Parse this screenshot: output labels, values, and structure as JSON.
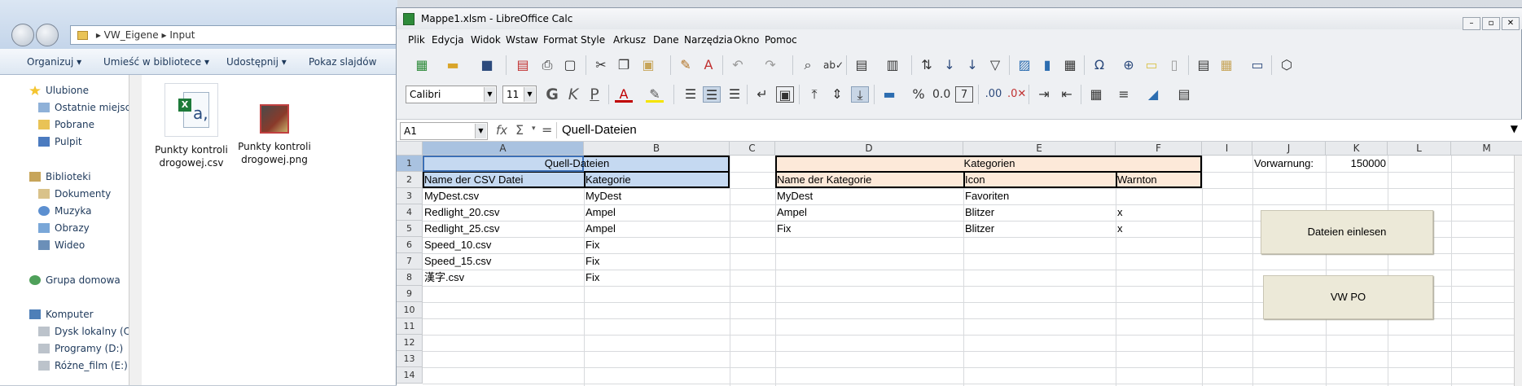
{
  "explorer": {
    "breadcrumb": [
      "VW_Eigene",
      "Input"
    ],
    "toolbar": [
      "Organizuj",
      "Umieść w bibliotece",
      "Udostępnij",
      "Pokaz slajdów"
    ],
    "nav": {
      "favorites": "Ulubione",
      "favorites_items": [
        "Ostatnie miejsca",
        "Pobrane",
        "Pulpit"
      ],
      "libraries": "Biblioteki",
      "libraries_items": [
        "Dokumenty",
        "Muzyka",
        "Obrazy",
        "Wideo"
      ],
      "homegroup": "Grupa domowa",
      "computer": "Komputer",
      "computer_items": [
        "Dysk lokalny (C:)",
        "Programy (D:)",
        "Różne_film (E:)"
      ]
    },
    "files": [
      {
        "name_line1": "Punkty kontroli",
        "name_line2": "drogowej.csv",
        "icon": "excel-csv-icon"
      },
      {
        "name_line1": "Punkty kontroli",
        "name_line2": "drogowej.png",
        "icon": "image-thumbnail"
      }
    ]
  },
  "calc": {
    "title": "Mappe1.xlsm - LibreOffice Calc",
    "menu": [
      "Plik",
      "Edycja",
      "Widok",
      "Wstaw",
      "Format",
      "Style",
      "Arkusz",
      "Dane",
      "Narzędzia",
      "Okno",
      "Pomoc"
    ],
    "font_name": "Calibri",
    "font_size": "11",
    "name_box": "A1",
    "formula": "Quell-Dateien",
    "columns": [
      "A",
      "B",
      "C",
      "D",
      "E",
      "F",
      "I",
      "J",
      "K",
      "L",
      "M"
    ],
    "rows": [
      "1",
      "2",
      "3",
      "4",
      "5",
      "6",
      "7",
      "8",
      "9",
      "10",
      "11",
      "12",
      "13",
      "14"
    ],
    "cells": {
      "A1": "Quell-Dateien",
      "A2": "Name der CSV Datei",
      "B2": "Kategorie",
      "D1": "Kategorien",
      "D2": "Name der Kategorie",
      "E2": "Icon",
      "F2": "Warnton",
      "A3": "MyDest.csv",
      "B3": "MyDest",
      "D3": "MyDest",
      "E3": "Favoriten",
      "A4": "Redlight_20.csv",
      "B4": "Ampel",
      "D4": "Ampel",
      "E4": "Blitzer",
      "F4": "x",
      "A5": "Redlight_25.csv",
      "B5": "Ampel",
      "D5": "Fix",
      "E5": "Blitzer",
      "F5": "x",
      "A6": "Speed_10.csv",
      "B6": "Fix",
      "A7": "Speed_15.csv",
      "B7": "Fix",
      "A8": "漢字.csv",
      "B8": "Fix",
      "J1": "Vorwarnung:",
      "K1": "150000"
    },
    "buttons": {
      "read_files": "Dateien einlesen",
      "vw_po": "VW PO"
    },
    "colors": {
      "header_blue": "#c5d9f1",
      "header_peach": "#fde9d9",
      "selection": "#a9c2e0"
    }
  }
}
